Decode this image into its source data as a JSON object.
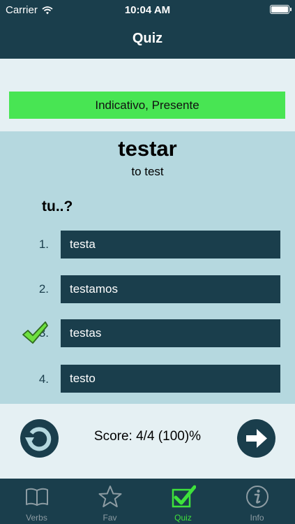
{
  "status_bar": {
    "carrier": "Carrier",
    "time": "10:04 AM"
  },
  "nav": {
    "title": "Quiz"
  },
  "tense": "Indicativo, Presente",
  "verb": {
    "infinitive": "testar",
    "translation": "to test"
  },
  "pronoun": "tu..?",
  "options": [
    {
      "number": "1.",
      "text": "testa"
    },
    {
      "number": "2.",
      "text": "testamos"
    },
    {
      "number": "3.",
      "text": "testas",
      "selected": true,
      "correct": true
    },
    {
      "number": "4.",
      "text": "testo"
    }
  ],
  "score": {
    "label": "Score: 4/4 (100)%"
  },
  "tabs": [
    {
      "label": "Verbs",
      "icon": "book-icon"
    },
    {
      "label": "Fav",
      "icon": "star-icon"
    },
    {
      "label": "Quiz",
      "icon": "checkbox-icon",
      "active": true
    },
    {
      "label": "Info",
      "icon": "info-icon"
    }
  ],
  "colors": {
    "dark_teal": "#1a3e4c",
    "accent_green": "#48e553",
    "panel_blue": "#b5d8df",
    "background": "#e5f0f3"
  }
}
